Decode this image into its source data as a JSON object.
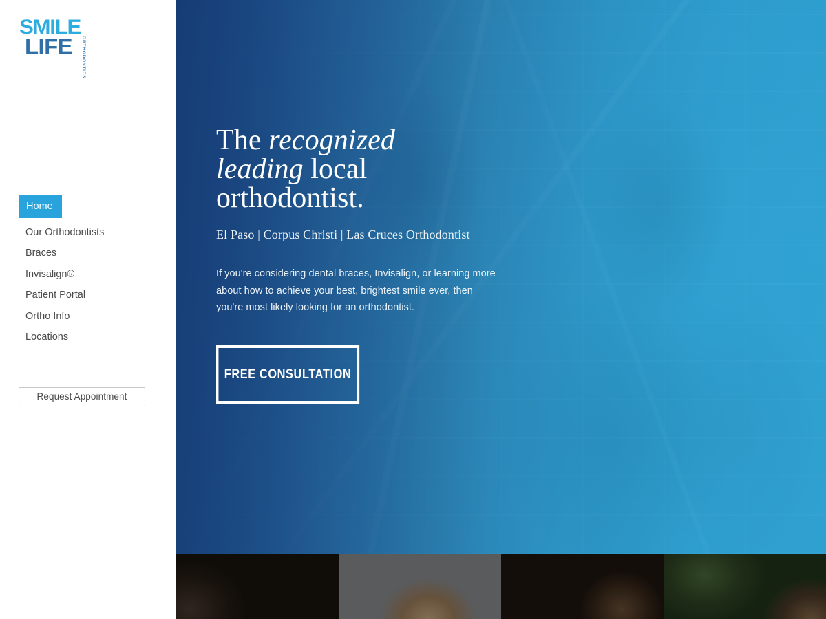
{
  "brand": {
    "logo_line1": "SMILE",
    "logo_line2": "LIFE",
    "logo_vertical": "ORTHODONTICS",
    "color_smile": "#2cacdf",
    "color_life": "#2f6fa6"
  },
  "sidebar": {
    "nav_items": [
      {
        "label": "Home",
        "active": true
      },
      {
        "label": "Our Orthodontists",
        "active": false
      },
      {
        "label": "Braces",
        "active": false
      },
      {
        "label": "Invisalign®",
        "active": false
      },
      {
        "label": "Patient Portal",
        "active": false
      },
      {
        "label": "Ortho Info",
        "active": false
      },
      {
        "label": "Locations",
        "active": false
      }
    ],
    "appointment_button": "Request Appointment",
    "active_bg": "#29a3dc"
  },
  "hero": {
    "title_part1": "The ",
    "title_italic": "recognized leading",
    "title_part2": " local orthodontist.",
    "subtitle": "El Paso | Corpus Christi | Las Cruces Orthodontist",
    "body": "If you're considering dental braces, Invisalign, or learning more about how to achieve your best, brightest smile ever, then you're most likely looking for an orthodontist.",
    "cta_label": "FREE CONSULTATION",
    "overlay_color_left": "#173e7a",
    "overlay_color_right": "#28b4e6"
  },
  "strip": {
    "tiles": [
      {
        "name": "photo-tile-1"
      },
      {
        "name": "photo-tile-2"
      },
      {
        "name": "photo-tile-3"
      },
      {
        "name": "photo-tile-4"
      }
    ]
  }
}
